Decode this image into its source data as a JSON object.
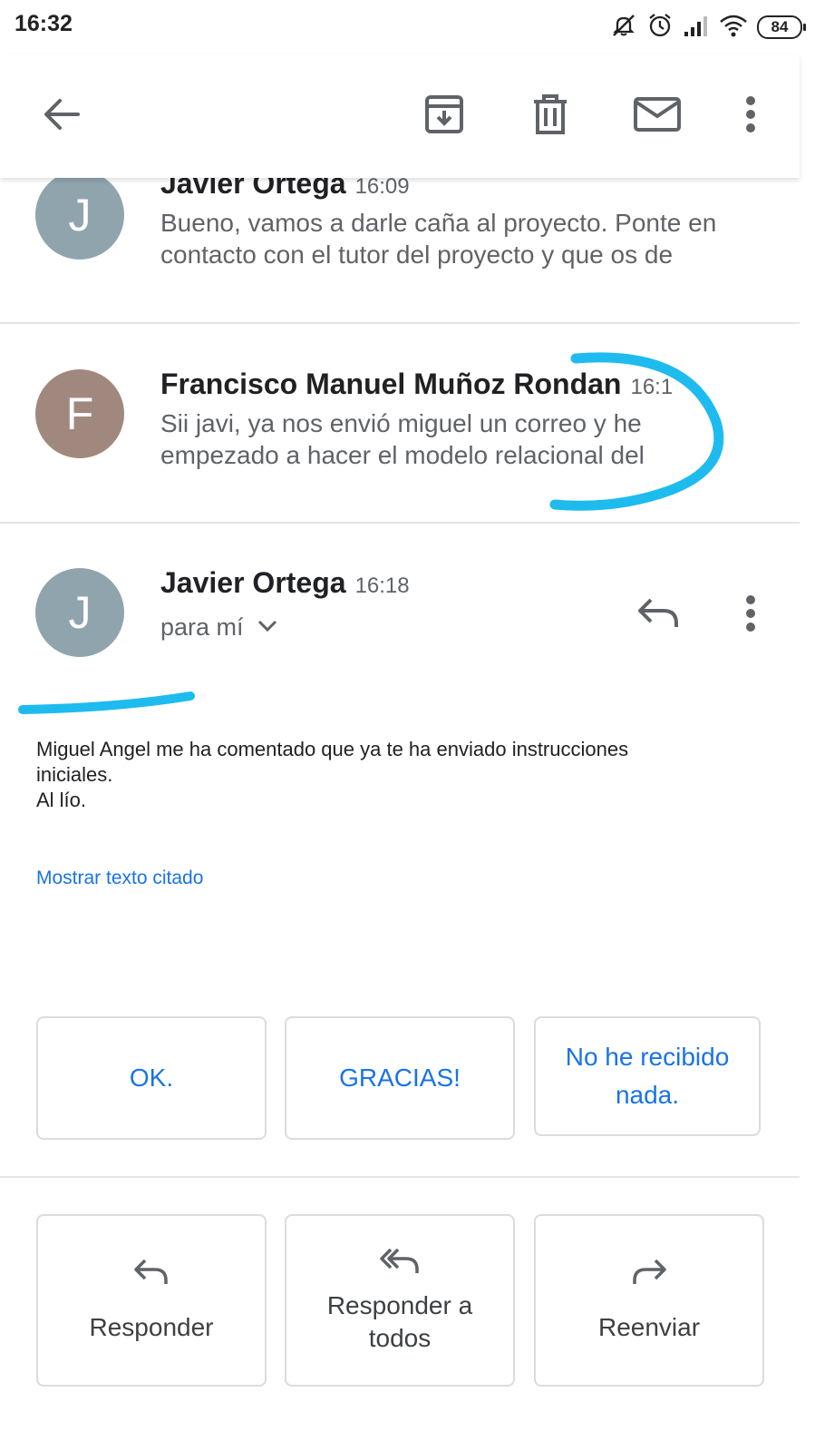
{
  "status_bar": {
    "time": "16:32",
    "battery": "84",
    "icons": [
      "mute-icon",
      "alarm-icon",
      "signal-icon",
      "wifi-icon",
      "battery-icon"
    ]
  },
  "toolbar": {
    "icons": [
      "back-arrow-icon",
      "archive-icon",
      "trash-icon",
      "mail-icon",
      "more-vert-icon"
    ]
  },
  "messages": [
    {
      "initial": "J",
      "avatar_color": "#90a4ae",
      "sender": "Javier Ortega",
      "time": "16:09",
      "snippet": "Bueno, vamos a darle caña al proyecto. Ponte en contacto con el tutor del proyecto y que os de"
    },
    {
      "initial": "F",
      "avatar_color": "#a1887f",
      "sender": "Francisco Manuel Muñoz Rondan",
      "time": "16:1",
      "snippet": "Sii javi, ya nos envió miguel un correo y he empezado a hacer el modelo relacional del"
    }
  ],
  "open_message": {
    "initial": "J",
    "avatar_color": "#90a4ae",
    "sender": "Javier Ortega",
    "time": "16:18",
    "recipient": "para mí",
    "body_lines": [
      "Miguel Angel me ha comentado que ya te ha enviado instrucciones",
      "iniciales.",
      "Al lío."
    ],
    "show_quoted": "Mostrar texto citado"
  },
  "smart_replies": [
    "OK.",
    "GRACIAS!",
    "No he recibido nada."
  ],
  "actions": [
    {
      "label": "Responder",
      "icon": "reply-icon"
    },
    {
      "label": "Responder a todos",
      "icon": "reply-all-icon"
    },
    {
      "label": "Reenviar",
      "icon": "forward-icon"
    }
  ],
  "colors": {
    "accent": "#1a73e8",
    "annotation": "#1ebbee"
  }
}
